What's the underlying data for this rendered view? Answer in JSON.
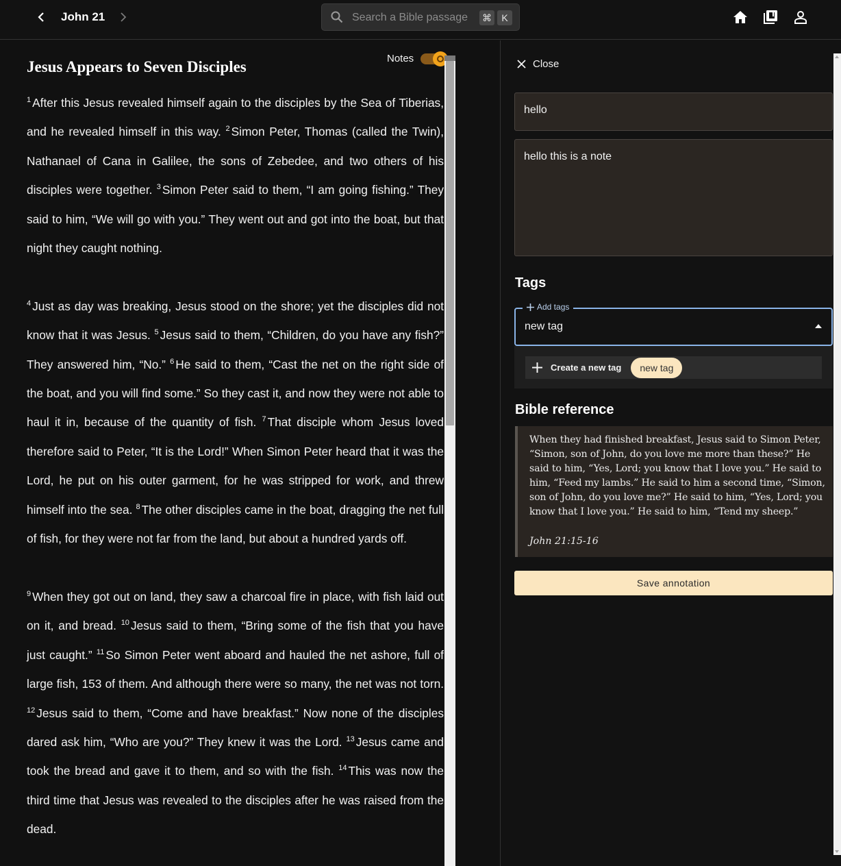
{
  "header": {
    "chapter": "John 21",
    "search_placeholder": "Search a Bible passage",
    "shortcut_key1": "⌘",
    "shortcut_key2": "K",
    "icons": [
      "chevron-left-icon",
      "chevron-right-icon",
      "search-icon",
      "home-icon",
      "library-icon",
      "user-icon"
    ]
  },
  "reader": {
    "heading": "Jesus Appears to Seven Disciples",
    "notes_label": "Notes",
    "notes_enabled": true,
    "verses": [
      {
        "n": "1",
        "text": "After this Jesus revealed himself again to the disciples by the Sea of Tiberias, and he revealed himself in this way."
      },
      {
        "n": "2",
        "text": "Simon Peter, Thomas (called the Twin), Nathanael of Cana in Galilee, the sons of Zebedee, and two others of his disciples were together."
      },
      {
        "n": "3",
        "text": "Simon Peter said to them, “I am going fishing.” They said to him, “We will go with you.” They went out and got into the boat, but that night they caught nothing."
      },
      {
        "n": "4",
        "text": "Just as day was breaking, Jesus stood on the shore; yet the disciples did not know that it was Jesus."
      },
      {
        "n": "5",
        "text": "Jesus said to them, “Children, do you have any fish?” They answered him, “No.”"
      },
      {
        "n": "6",
        "text": "He said to them, “Cast the net on the right side of the boat, and you will find some.” So they cast it, and now they were not able to haul it in, because of the quantity of fish."
      },
      {
        "n": "7",
        "text": "That disciple whom Jesus loved therefore said to Peter, “It is the Lord!” When Simon Peter heard that it was the Lord, he put on his outer garment, for he was stripped for work, and threw himself into the sea."
      },
      {
        "n": "8",
        "text": "The other disciples came in the boat, dragging the net full of fish, for they were not far from the land, but about a hundred yards off."
      },
      {
        "n": "9",
        "text": "When they got out on land, they saw a charcoal fire in place, with fish laid out on it, and bread."
      },
      {
        "n": "10",
        "text": "Jesus said to them, “Bring some of the fish that you have just caught.”"
      },
      {
        "n": "11",
        "text": "So Simon Peter went aboard and hauled the net ashore, full of large fish, 153 of them. And although there were so many, the net was not torn."
      },
      {
        "n": "12",
        "text": "Jesus said to them, “Come and have breakfast.” Now none of the disciples dared ask him, “Who are you?” They knew it was the Lord."
      },
      {
        "n": "13",
        "text": "Jesus came and took the bread and gave it to them, and so with the fish."
      },
      {
        "n": "14",
        "text": "This was now the third time that Jesus was revealed to the disciples after he was raised from the dead."
      }
    ]
  },
  "panel": {
    "close_label": "Close",
    "title_value": "hello",
    "note_value": "hello this is a note",
    "tags_heading": "Tags",
    "tags_legend": "Add tags",
    "tags_input_value": "new tag",
    "create_tag_label": "Create a new tag",
    "new_tag_chip": "new tag",
    "ref_heading": "Bible reference",
    "ref_text": "When they had finished breakfast, Jesus said to Simon Peter, “Simon, son of John, do you love me more than these?” He said to him, “Yes, Lord; you know that I love you.” He said to him, “Feed my lambs.” He said to him a second time, “Simon, son of John, do you love me?” He said to him, “Yes, Lord; you know that I love you.” He said to him, “Tend my sheep.”",
    "ref_citation": "John 21:15-16",
    "save_label": "Save annotation"
  },
  "colors": {
    "background": "#111111",
    "accent_cream": "#fbe6bf",
    "toggle_orange": "#f2a31b",
    "focus_blue": "#8ab4e8"
  }
}
